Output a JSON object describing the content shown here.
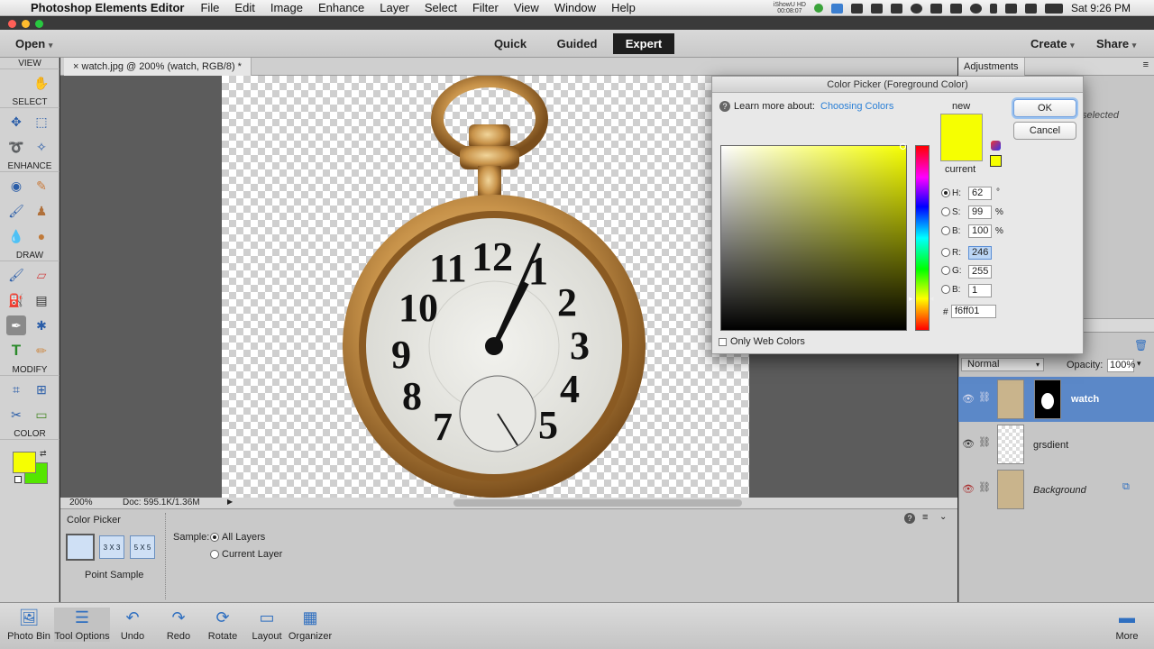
{
  "menubar": {
    "app_name": "Photoshop Elements Editor",
    "items": [
      "File",
      "Edit",
      "Image",
      "Enhance",
      "Layer",
      "Select",
      "Filter",
      "View",
      "Window",
      "Help"
    ],
    "ishow_line1": "iShowU HD",
    "ishow_line2": "00:08:07",
    "clock": "Sat 9:26 PM"
  },
  "topbar": {
    "open_label": "Open",
    "tabs": [
      "Quick",
      "Guided",
      "Expert"
    ],
    "active_tab": "Expert",
    "create_label": "Create",
    "share_label": "Share"
  },
  "tools": {
    "sections": [
      "VIEW",
      "SELECT",
      "ENHANCE",
      "DRAW",
      "MODIFY",
      "COLOR"
    ],
    "fg_color": "#f6ff01",
    "bg_color": "#55e600"
  },
  "document": {
    "tab_title": "watch.jpg @ 200% (watch, RGB/8) *",
    "zoom": "200%",
    "doc_size": "Doc: 595.1K/1.36M"
  },
  "tool_options": {
    "title": "Color Picker",
    "sizes": [
      "3 X 3",
      "5 X 5"
    ],
    "point_sample_label": "Point Sample",
    "sample_label": "Sample:",
    "sample_options": [
      "All Layers",
      "Current Layer"
    ],
    "selected_option": "All Layers"
  },
  "bottom_bar": {
    "items": [
      "Photo Bin",
      "Tool Options",
      "Undo",
      "Redo",
      "Rotate",
      "Layout",
      "Organizer"
    ],
    "more_label": "More"
  },
  "right_panel": {
    "tab": "Adjustments",
    "partial_text": "selected",
    "blend_mode": "Normal",
    "opacity_label": "Opacity:",
    "opacity_value": "100%",
    "layers": [
      "watch",
      "grsdient",
      "Background"
    ]
  },
  "color_picker": {
    "title": "Color Picker (Foreground Color)",
    "learn_more": "Learn more about:",
    "learn_link": "Choosing Colors",
    "new_label": "new",
    "current_label": "current",
    "ok_label": "OK",
    "cancel_label": "Cancel",
    "fields": {
      "H": {
        "label": "H:",
        "value": "62",
        "unit": "°"
      },
      "S": {
        "label": "S:",
        "value": "99",
        "unit": "%"
      },
      "Bv": {
        "label": "B:",
        "value": "100",
        "unit": "%"
      },
      "R": {
        "label": "R:",
        "value": "246"
      },
      "G": {
        "label": "G:",
        "value": "255"
      },
      "B": {
        "label": "B:",
        "value": "1"
      }
    },
    "hex_label": "#",
    "hex_value": "f6ff01",
    "web_colors_label": "Only Web Colors",
    "new_color": "#f6ff01",
    "current_color": "#f6ff01"
  }
}
